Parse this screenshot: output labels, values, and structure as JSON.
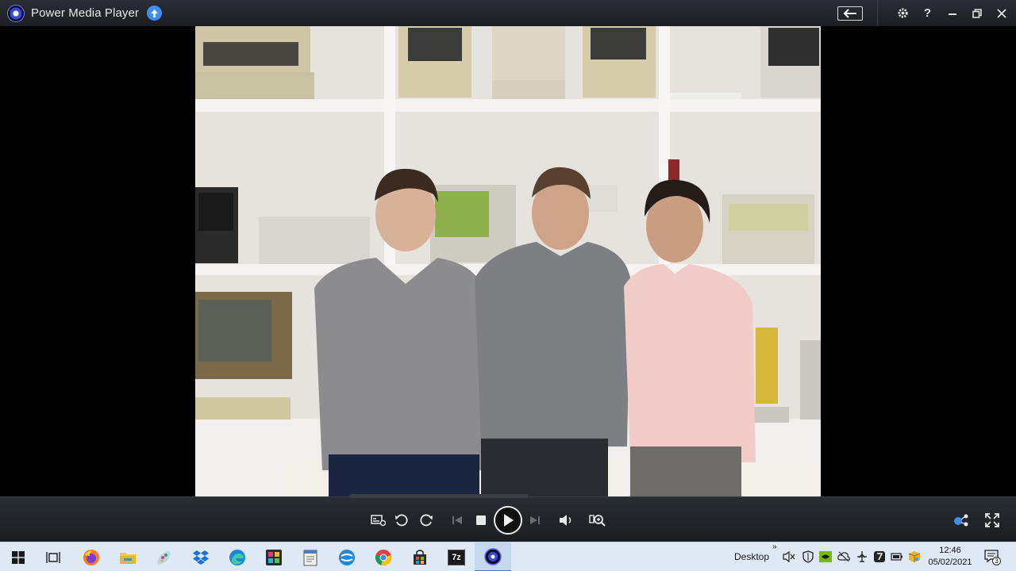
{
  "window": {
    "title": "Power Media Player",
    "title_icons": {
      "logo": "power-media-player-logo-icon",
      "update": "arrow-up-circle-icon"
    },
    "controls": [
      "back-arrow-icon",
      "gear-icon",
      "help-icon",
      "minimize-icon",
      "restore-icon",
      "close-icon"
    ],
    "help_label": "?"
  },
  "player": {
    "controls": [
      "subtitle-settings-icon",
      "rotate-left-icon",
      "rotate-right-icon",
      "previous-icon",
      "stop-icon",
      "play-icon",
      "next-icon",
      "volume-icon",
      "zoom-icon"
    ],
    "right_controls": [
      "share-icon",
      "fullscreen-icon"
    ]
  },
  "taskbar": {
    "apps": [
      "windows-start-icon",
      "task-view-icon",
      "firefox-icon",
      "file-explorer-icon",
      "paint-icon",
      "dropbox-icon",
      "edge-icon",
      "photo-app-icon",
      "notepad-icon",
      "app-swirl-icon",
      "chrome-icon",
      "store-icon",
      "7zip-icon",
      "power-media-player-icon"
    ],
    "sevenzip_label": "7z",
    "desktop_label": "Desktop",
    "tray_chevron": "»",
    "time": "12:46",
    "date": "05/02/2021",
    "notification_count": "3"
  },
  "colors": {
    "accent": "#3c8ff0",
    "titlebar": "#22252b",
    "taskbar": "#dfe9f5"
  }
}
